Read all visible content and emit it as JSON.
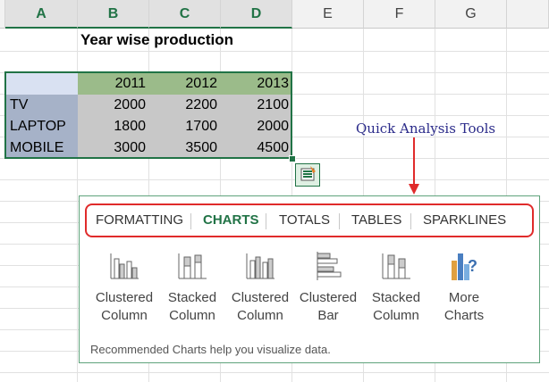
{
  "columns": [
    "A",
    "B",
    "C",
    "D",
    "E",
    "F",
    "G"
  ],
  "sheet": {
    "title": "Year wise production",
    "years": [
      "2011",
      "2012",
      "2013"
    ],
    "rows": [
      {
        "label": "TV",
        "values": [
          "2000",
          "2200",
          "2100"
        ]
      },
      {
        "label": "LAPTOP",
        "values": [
          "1800",
          "1700",
          "2000"
        ]
      },
      {
        "label": "MOBILE",
        "values": [
          "3000",
          "3500",
          "4500"
        ]
      }
    ]
  },
  "annotation": {
    "callout": "Quick Analysis Tools",
    "arrow_color": "#e02b2b"
  },
  "quick_analysis": {
    "tabs": [
      {
        "label": "FORMATTING"
      },
      {
        "label": "CHARTS",
        "active": true
      },
      {
        "label": "TOTALS"
      },
      {
        "label": "TABLES"
      },
      {
        "label": "SPARKLINES"
      }
    ],
    "options": [
      {
        "line1": "Clustered",
        "line2": "Column",
        "icon": "clustered-column-icon"
      },
      {
        "line1": "Stacked",
        "line2": "Column",
        "icon": "stacked-column-icon"
      },
      {
        "line1": "Clustered",
        "line2": "Column",
        "icon": "clustered-column-icon"
      },
      {
        "line1": "Clustered",
        "line2": "Bar",
        "icon": "clustered-bar-icon"
      },
      {
        "line1": "Stacked",
        "line2": "Column",
        "icon": "stacked-column-icon"
      },
      {
        "line1": "More",
        "line2": "Charts",
        "icon": "more-charts-icon"
      }
    ],
    "footer": "Recommended Charts help you visualize data."
  },
  "colors": {
    "accent": "#217346",
    "year_header_bg": "#9bbb8a",
    "label_bg": "#a6b2c8",
    "data_bg": "#c8c8c8",
    "highlight_red": "#e02b2b"
  }
}
